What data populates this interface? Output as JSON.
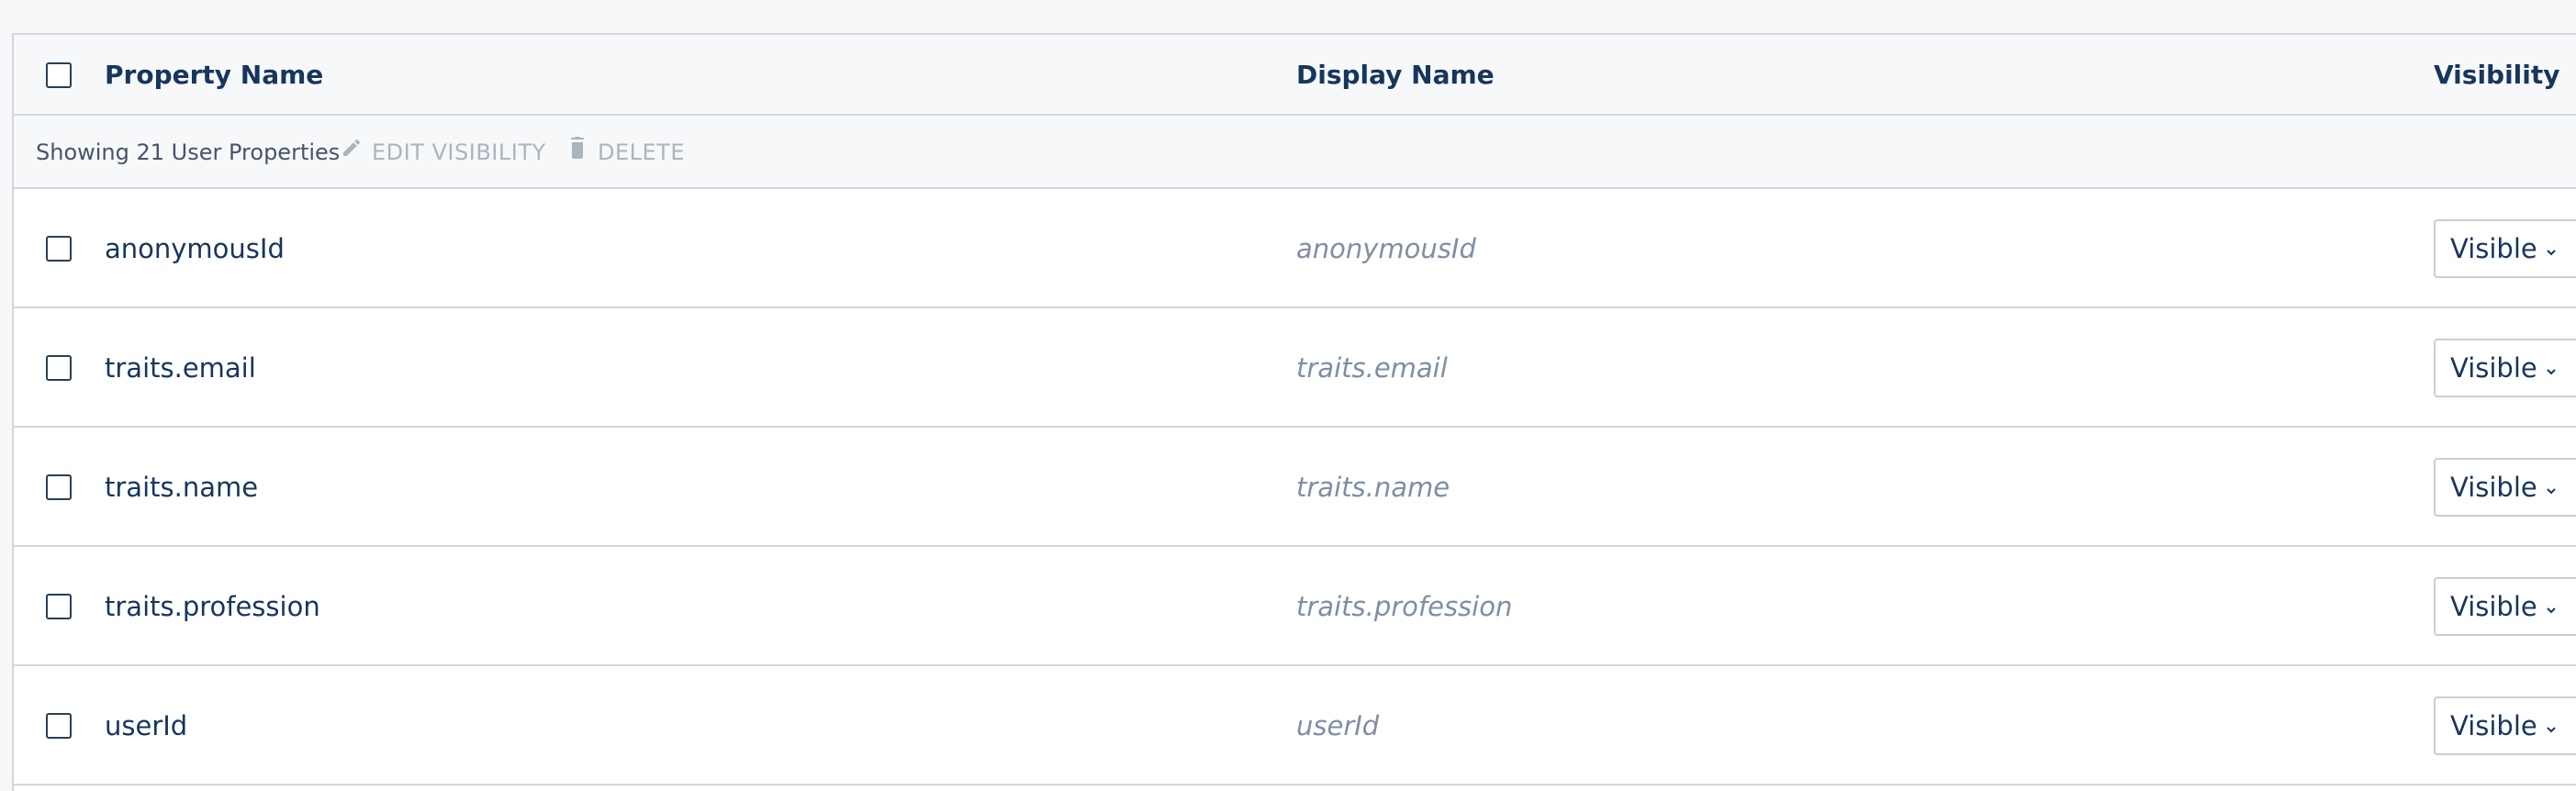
{
  "table": {
    "headers": {
      "property_name": "Property Name",
      "display_name": "Display Name",
      "visibility": "Visibility"
    },
    "toolbar": {
      "showing_text": "Showing 21 User Properties",
      "edit_visibility_label": "EDIT VISIBILITY",
      "delete_label": "DELETE"
    },
    "rows": [
      {
        "property": "anonymousId",
        "display_placeholder": "anonymousId",
        "visibility": "Visible"
      },
      {
        "property": "traits.email",
        "display_placeholder": "traits.email",
        "visibility": "Visible"
      },
      {
        "property": "traits.name",
        "display_placeholder": "traits.name",
        "visibility": "Visible"
      },
      {
        "property": "traits.profession",
        "display_placeholder": "traits.profession",
        "visibility": "Visible"
      },
      {
        "property": "userId",
        "display_placeholder": "userId",
        "visibility": "Visible"
      }
    ]
  },
  "icons": {
    "edit": "pencil-icon",
    "delete": "trash-icon",
    "dropdown": "chevron-down-icon"
  },
  "colors": {
    "text_primary": "#17365c",
    "text_placeholder": "#7e8fa3",
    "text_disabled": "#aab4bf",
    "border": "#d3d7db",
    "header_bg": "#f7f8f9"
  }
}
